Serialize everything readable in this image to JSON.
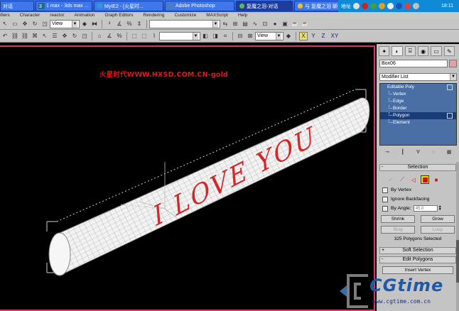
{
  "taskbar": {
    "buttons": [
      {
        "label": "对话",
        "active": false
      },
      {
        "label": "1 max - 3ds max ...",
        "active": false
      },
      {
        "label": "MyIE2 - [火星时...",
        "active": false
      },
      {
        "label": "Adobe Photoshop",
        "active": false
      },
      {
        "label": "复魔之泪-对话",
        "active": true
      },
      {
        "label": "与 复魔之泪 聊天中",
        "active": false
      }
    ],
    "tray_label": "地址",
    "clock": "18:11"
  },
  "menubar": {
    "items": [
      "ifiers",
      "Character",
      "reactor",
      "Animation",
      "Graph Editors",
      "Rendering",
      "Customize",
      "MAXScript",
      "Help"
    ]
  },
  "toolbar1": {
    "view_dropdown": "View"
  },
  "toolbar2": {
    "view_dropdown": "View",
    "axes": [
      "X",
      "Y",
      "Z",
      "XY"
    ]
  },
  "viewport": {
    "watermark": "火星时代WWW.HXSD.COM.CN-gold",
    "model_text": "I LOVE YOU"
  },
  "panel": {
    "object_name": "Box06",
    "modifier_list": "Modifier List",
    "stack": [
      {
        "label": "Editable Poly",
        "root": true,
        "selected": false,
        "check": true
      },
      {
        "label": "Vertex",
        "root": false,
        "selected": false,
        "check": false
      },
      {
        "label": "Edge",
        "root": false,
        "selected": false,
        "check": false
      },
      {
        "label": "Border",
        "root": false,
        "selected": false,
        "check": false
      },
      {
        "label": "Polygon",
        "root": false,
        "selected": true,
        "check": true
      },
      {
        "label": "Element",
        "root": false,
        "selected": false,
        "check": false
      }
    ],
    "selection": {
      "title": "Selection",
      "by_vertex": "By Vertex",
      "ignore_backfacing": "Ignore Backfacing",
      "by_angle": "By Angle:",
      "angle_value": "45.0",
      "shrink": "Shrink",
      "grow": "Grow",
      "ring": "Ring",
      "loop": "Loop",
      "status": "325 Polygons Selected"
    },
    "soft_selection": "Soft Selection",
    "edit_polygons": "Edit Polygons",
    "insert_vertex": "Insert Vertex"
  },
  "logo": {
    "text": "CGtime",
    "url": "www.cgtime.com.cn"
  }
}
